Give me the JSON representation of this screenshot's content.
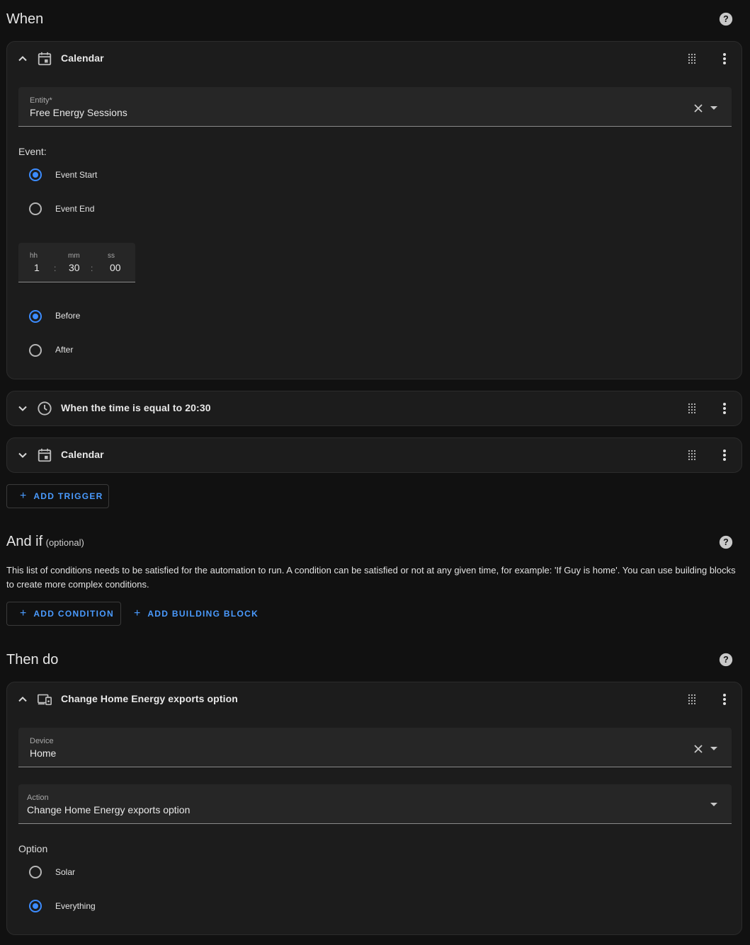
{
  "when": {
    "title": "When",
    "triggers": [
      {
        "title": "Calendar",
        "entity": {
          "label": "Entity*",
          "value": "Free Energy Sessions"
        },
        "event": {
          "label": "Event:",
          "options": [
            {
              "label": "Event Start",
              "selected": true
            },
            {
              "label": "Event End",
              "selected": false
            }
          ]
        },
        "offset": {
          "hh_label": "hh",
          "mm_label": "mm",
          "ss_label": "ss",
          "hh": "1",
          "mm": "30",
          "ss": "00",
          "sep": ":"
        },
        "direction": {
          "options": [
            {
              "label": "Before",
              "selected": true
            },
            {
              "label": "After",
              "selected": false
            }
          ]
        }
      },
      {
        "title": "When the time is equal to 20:30"
      },
      {
        "title": "Calendar"
      }
    ],
    "add_trigger": "ADD TRIGGER"
  },
  "and_if": {
    "title": "And if",
    "optional": "(optional)",
    "description": "This list of conditions needs to be satisfied for the automation to run. A condition can be satisfied or not at any given time, for example: 'If Guy is home'. You can use building blocks to create more complex conditions.",
    "add_condition": "ADD CONDITION",
    "add_building_block": "ADD BUILDING BLOCK"
  },
  "then_do": {
    "title": "Then do",
    "action_card": {
      "title": "Change Home Energy exports option",
      "device": {
        "label": "Device",
        "value": "Home"
      },
      "action": {
        "label": "Action",
        "value": "Change Home Energy exports option"
      },
      "option": {
        "label": "Option",
        "options": [
          {
            "label": "Solar",
            "selected": false
          },
          {
            "label": "Everything",
            "selected": true
          }
        ]
      }
    }
  },
  "colors": {
    "accent": "#3c8cff",
    "background": "#111111",
    "card": "#1c1c1c",
    "field": "#262626"
  }
}
